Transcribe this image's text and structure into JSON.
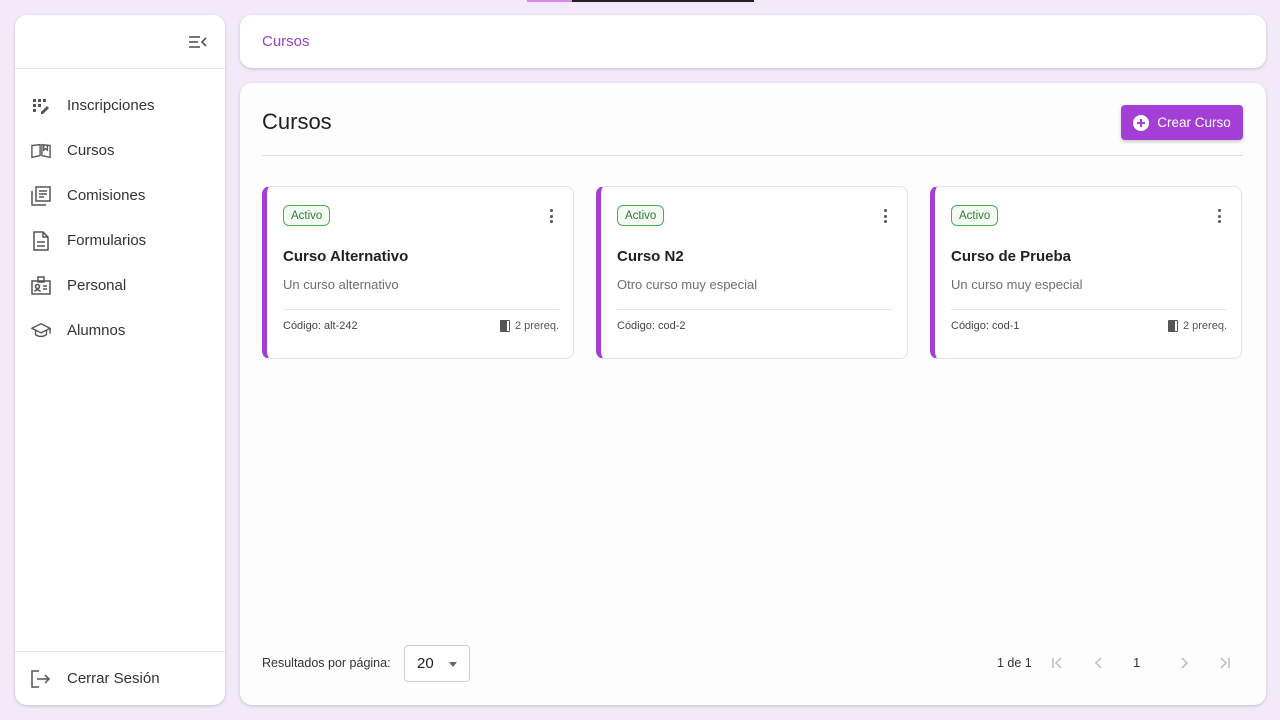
{
  "sidebar": {
    "items": [
      {
        "label": "Inscripciones",
        "icon": "inscripciones-icon"
      },
      {
        "label": "Cursos",
        "icon": "book-open-icon"
      },
      {
        "label": "Comisiones",
        "icon": "list-icon"
      },
      {
        "label": "Formularios",
        "icon": "document-icon"
      },
      {
        "label": "Personal",
        "icon": "id-badge-icon"
      },
      {
        "label": "Alumnos",
        "icon": "graduation-cap-icon"
      }
    ],
    "logout_label": "Cerrar Sesión"
  },
  "breadcrumb": {
    "current": "Cursos"
  },
  "main": {
    "title": "Cursos",
    "create_button": "Crear Curso",
    "cards": [
      {
        "status": "Activo",
        "title": "Curso Alternativo",
        "description": "Un curso alternativo",
        "code": "Código: alt-242",
        "prereq": "2 prereq."
      },
      {
        "status": "Activo",
        "title": "Curso N2",
        "description": "Otro curso muy especial",
        "code": "Código: cod-2",
        "prereq": ""
      },
      {
        "status": "Activo",
        "title": "Curso de Prueba",
        "description": "Un curso muy especial",
        "code": "Código: cod-1",
        "prereq": "2 prereq."
      }
    ]
  },
  "pagination": {
    "rows_label": "Resultados por página:",
    "rows_value": "20",
    "page_info": "1 de 1",
    "current_page": "1"
  },
  "colors": {
    "accent": "#a33fd6",
    "background": "#f3e9f8",
    "status_active": "#4caf50"
  }
}
